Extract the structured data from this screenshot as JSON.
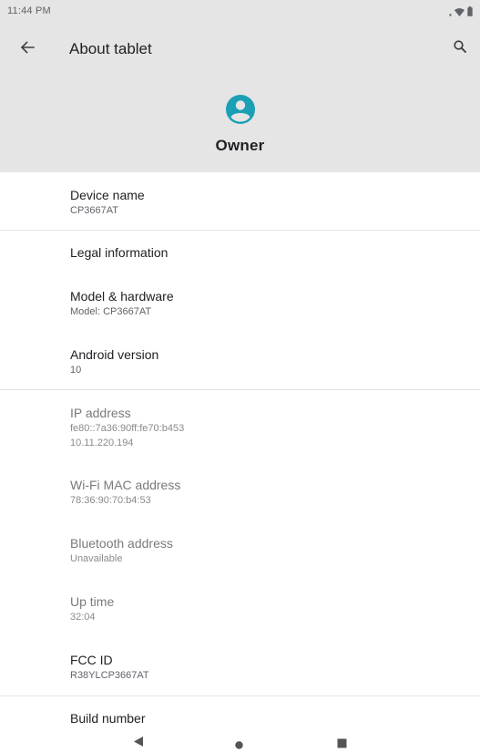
{
  "status_bar": {
    "time": "11:44 PM"
  },
  "toolbar": {
    "title": "About tablet",
    "back_icon": "arrow-left-icon",
    "search_icon": "search-icon"
  },
  "profile": {
    "name": "Owner",
    "avatar_icon": "account-circle-icon",
    "accent_color": "#1a9fb5"
  },
  "items": {
    "device_name": {
      "title": "Device name",
      "subtitle": "CP3667AT"
    },
    "legal": {
      "title": "Legal information"
    },
    "model": {
      "title": "Model & hardware",
      "subtitle": "Model: CP3667AT"
    },
    "android": {
      "title": "Android version",
      "subtitle": "10"
    },
    "ip": {
      "title": "IP address",
      "subtitle_1": "fe80::7a36:90ff:fe70:b453",
      "subtitle_2": "10.11.220.194"
    },
    "wifi_mac": {
      "title": "Wi-Fi MAC address",
      "subtitle": "78:36:90:70:b4:53"
    },
    "bluetooth": {
      "title": "Bluetooth address",
      "subtitle": "Unavailable"
    },
    "uptime": {
      "title": "Up time",
      "subtitle": "32:04"
    },
    "fcc": {
      "title": "FCC ID",
      "subtitle": "R38YLCP3667AT"
    },
    "build": {
      "title": "Build number"
    }
  },
  "nav_bar": {
    "back_icon": "triangle-back-icon",
    "home_icon": "circle-home-icon",
    "recents_icon": "square-recents-icon"
  }
}
